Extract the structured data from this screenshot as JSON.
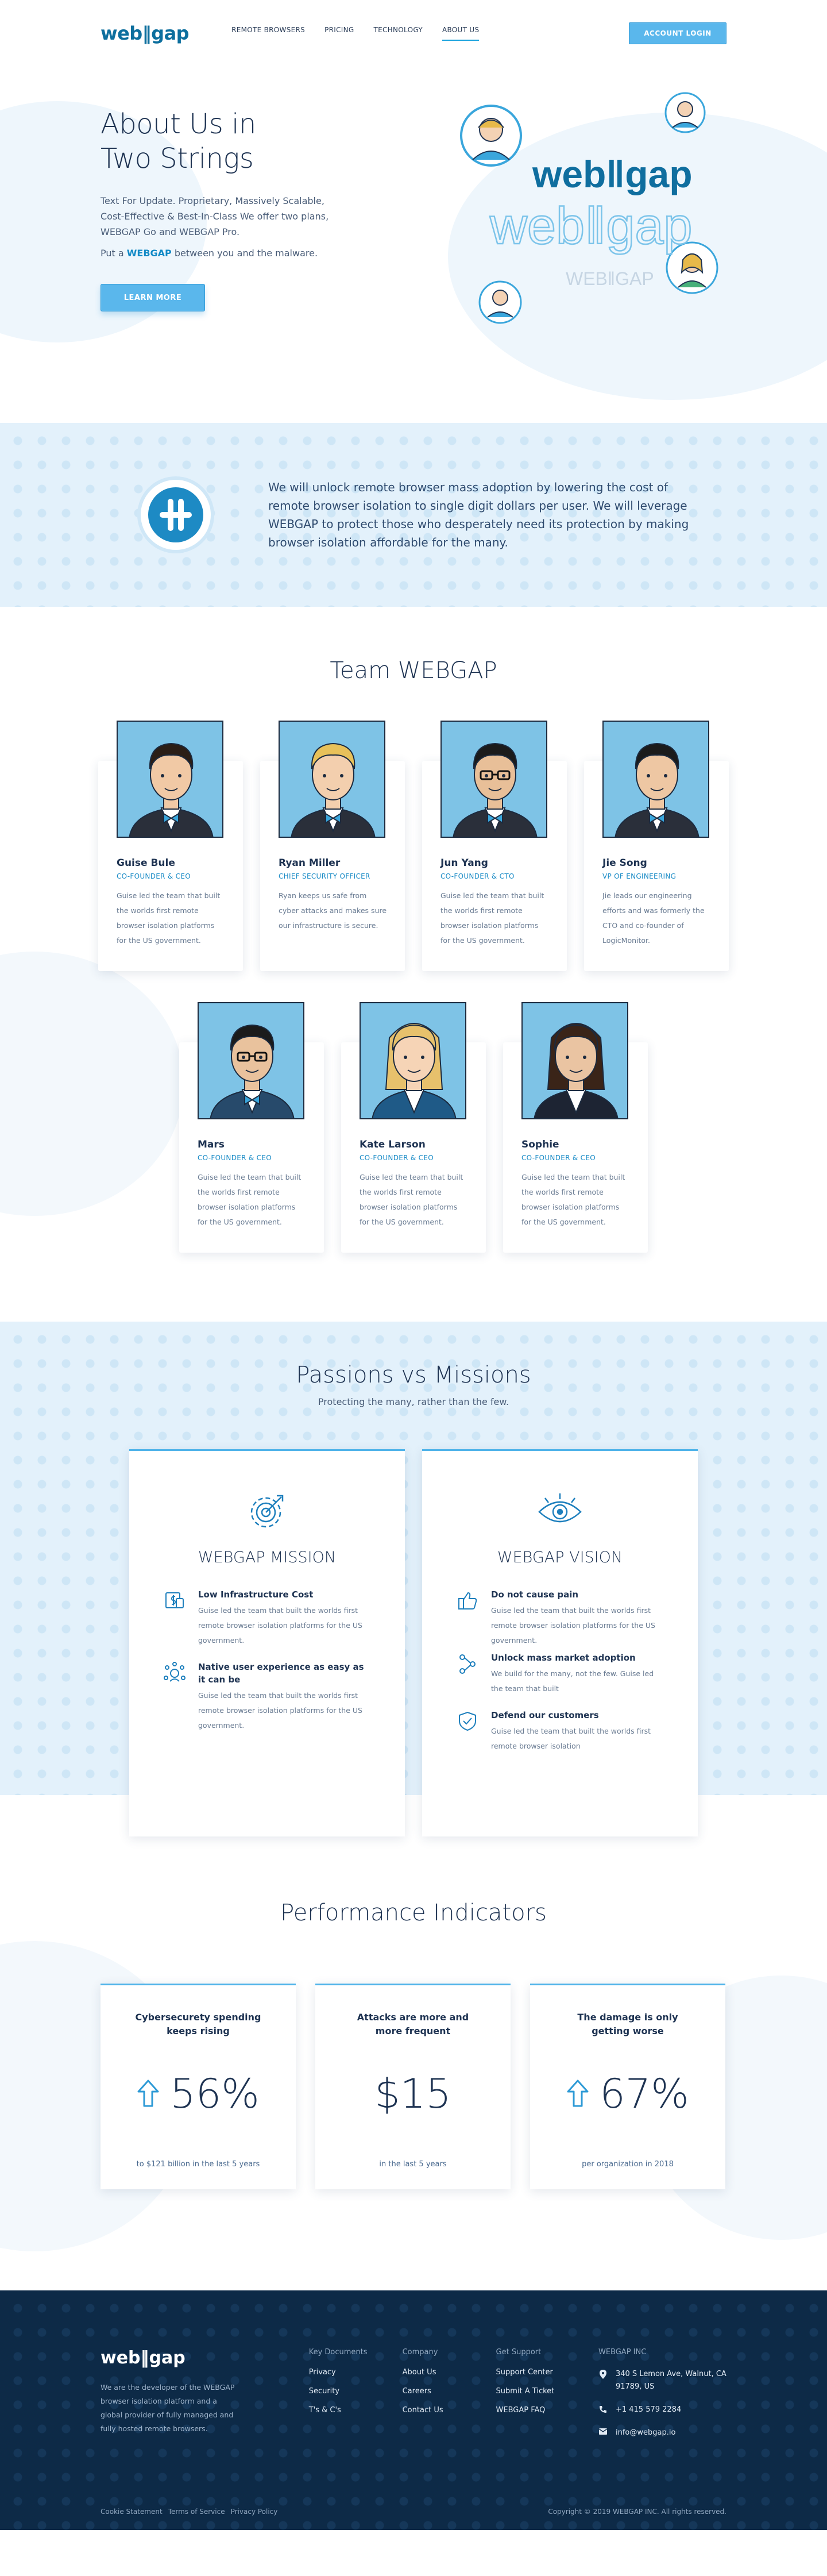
{
  "header": {
    "logo": "web‖gap",
    "nav": [
      "REMOTE BROWSERS",
      "PRICING",
      "TECHNOLOGY",
      "ABOUT US"
    ],
    "active_nav": "ABOUT US",
    "login_label": "ACCOUNT LOGIN"
  },
  "hero": {
    "title_line1": "About Us in",
    "title_line2": "Two Strings",
    "description": "Text For Update. Proprietary, Massively Scalable, Cost-Effective & Best-In-Class We offer two plans, WEBGAP Go and WEBGAP Pro.",
    "put_prefix": "Put a",
    "put_brand": "WEBGAP",
    "put_suffix": "between you and the malware.",
    "button": "LEARN MORE",
    "logo_text_main": "web‖gap",
    "logo_text_outline": "web‖gap",
    "logo_text_small": "WEB‖GAP"
  },
  "mission": {
    "text": "We will unlock remote browser mass adoption by lowering the cost of remote browser isolation to single digit dollars per user. We will leverage WEBGAP to protect those who desperately need its protection by making browser isolation affordable for the many."
  },
  "team": {
    "title": "Team WEBGAP",
    "members": [
      {
        "name": "Guise Bule",
        "role": "CO-FOUNDER & CEO",
        "desc": "Guise led the team that built the worlds first remote browser isolation platforms for the US government."
      },
      {
        "name": "Ryan Miller",
        "role": "CHIEF SECURITY OFFICER",
        "desc": "Ryan keeps us safe from cyber attacks and makes sure our infrastructure is secure."
      },
      {
        "name": "Jun Yang",
        "role": "CO-FOUNDER & CTO",
        "desc": "Guise led the team that built the worlds first remote browser isolation platforms for the US government."
      },
      {
        "name": "Jie Song",
        "role": "VP OF ENGINEERING",
        "desc": "Jie leads our engineering efforts and was formerly the CTO and co-founder of LogicMonitor."
      },
      {
        "name": "Mars",
        "role": "CO-FOUNDER & CEO",
        "desc": "Guise led the team that built the worlds first remote browser isolation platforms for the US government."
      },
      {
        "name": "Kate Larson",
        "role": "CO-FOUNDER & CEO",
        "desc": "Guise led the team that built the worlds first remote browser isolation platforms for the US government."
      },
      {
        "name": "Sophie",
        "role": "CO-FOUNDER & CEO",
        "desc": "Guise led the team that built the worlds first remote browser isolation platforms for the US government."
      }
    ]
  },
  "passions": {
    "title": "Passions vs Missions",
    "subtitle": "Protecting the many, rather than the few.",
    "mission_card": {
      "title": "WEBGAP MISSION",
      "items": [
        {
          "title": "Low Infrastructure Cost",
          "desc": "Guise led the team that built the worlds first remote browser isolation platforms for the US government."
        },
        {
          "title": "Native user experience as easy as it can be",
          "desc": "Guise led the team that built the worlds first remote browser isolation platforms for the US government."
        }
      ]
    },
    "vision_card": {
      "title": "WEBGAP VISION",
      "items": [
        {
          "title": "Do not cause pain",
          "desc": "Guise led the team that built the worlds first remote browser isolation platforms for the US government."
        },
        {
          "title": "Unlock mass market adoption",
          "desc": "We build for the many, not the few. Guise led the team that built"
        },
        {
          "title": "Defend our customers",
          "desc": "Guise led the team that built the worlds first remote browser isolation"
        }
      ]
    }
  },
  "performance": {
    "title": "Performance Indicators",
    "kpis": [
      {
        "title": "Cybersecurety spending keeps rising",
        "value": "56%",
        "note": "to $121 billion in the last 5 years",
        "arrow": true
      },
      {
        "title": "Attacks are more and more frequent",
        "value": "$15",
        "note": "in the last 5 years",
        "arrow": false
      },
      {
        "title": "The damage is only getting worse",
        "value": "67%",
        "note": "per organization in 2018",
        "arrow": true
      }
    ]
  },
  "footer": {
    "logo": "web‖gap",
    "about": "We are the developer of the WEBGAP browser isolation platform and a global provider of fully managed and fully hosted remote browsers.",
    "col1": {
      "heading": "Key Documents",
      "links": [
        "Privacy",
        "Security",
        "T's & C's"
      ]
    },
    "col2": {
      "heading": "Company",
      "links": [
        "About Us",
        "Careers",
        "Contact Us"
      ]
    },
    "col3": {
      "heading": "Get Support",
      "links": [
        "Support Center",
        "Submit A Ticket",
        "WEBGAP FAQ"
      ]
    },
    "contact": {
      "heading": "WEBGAP INC",
      "address": "340 S Lemon Ave, Walnut, CA 91789, US",
      "phone": "+1 415 579 2284",
      "email": "info@webgap.io"
    },
    "bottom_links": [
      "Cookie Statement",
      "Terms of Service",
      "Privacy Policy"
    ],
    "copyright": "Copyright © 2019 WEBGAP INC. All rights reserved."
  },
  "colors": {
    "accent": "#17a2dd",
    "button": "#5ab7ec",
    "dark_navy": "#0d2a47",
    "light_band": "#e3f1fb"
  },
  "icons": [
    "logo-plus-icon",
    "target-icon",
    "eye-icon",
    "dollar-doc-icon",
    "users-network-icon",
    "thumbs-up-icon",
    "nodes-icon",
    "shield-icon",
    "arrow-up-icon",
    "location-icon",
    "phone-icon",
    "email-icon"
  ]
}
